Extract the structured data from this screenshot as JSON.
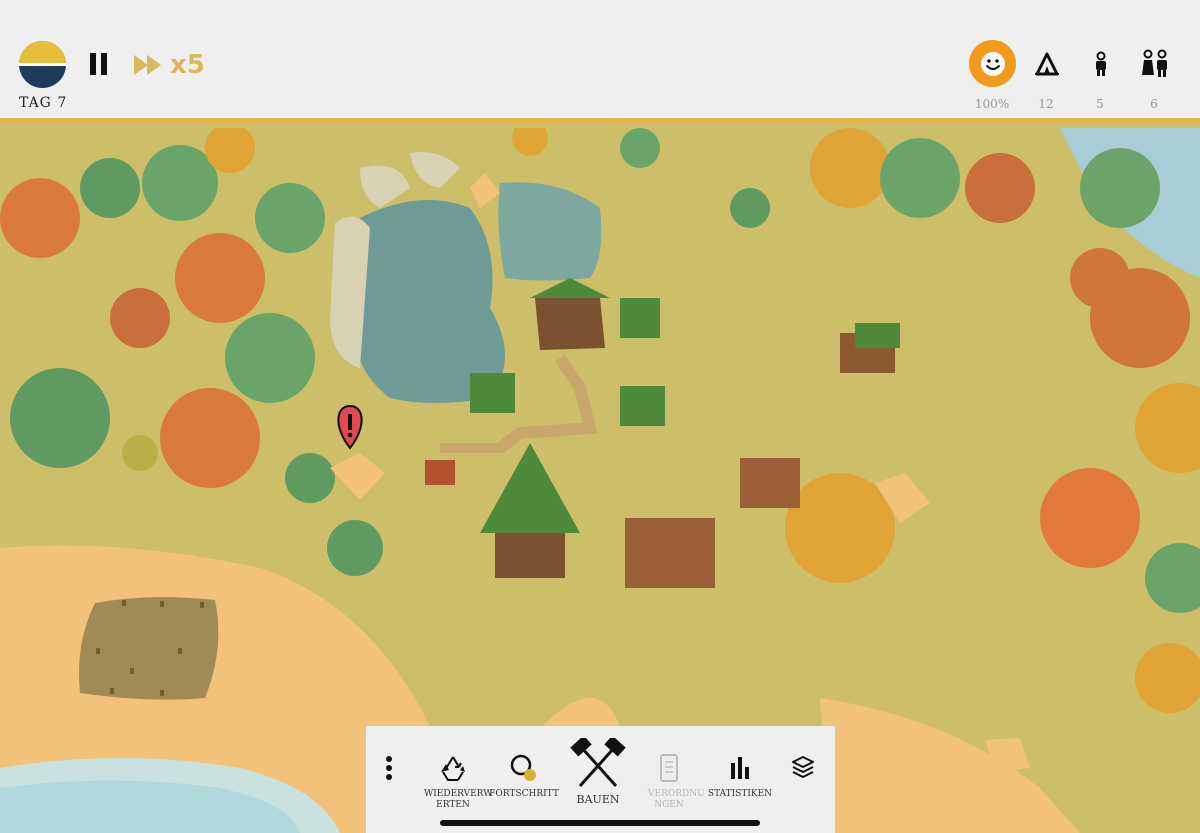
{
  "hud": {
    "day_label": "TAG 7",
    "speed_label": "x5",
    "stats": {
      "happiness": "100%",
      "shelter": "12",
      "population": "5",
      "families": "6"
    },
    "icons": {
      "day": "day-night-dial-icon",
      "pause": "pause-icon",
      "speed": "fast-forward-icon",
      "happiness": "smiley-face-icon",
      "shelter": "tent-icon",
      "population": "person-icon",
      "families": "couple-icon"
    },
    "colors": {
      "accent": "#e0b545",
      "happiness": "#f29a1e",
      "speed": "#d9b85a"
    }
  },
  "toolbar": {
    "recycle_label": "WIEDERVERW ERTEN",
    "progress_label": "FORTSCHRITT",
    "build_label": "BAUEN",
    "decrees_label": "VERORDNU NGEN",
    "stats_label": "STATISTIKEN"
  },
  "world": {
    "alert_icon": "exclamation-alert-marker-icon"
  }
}
